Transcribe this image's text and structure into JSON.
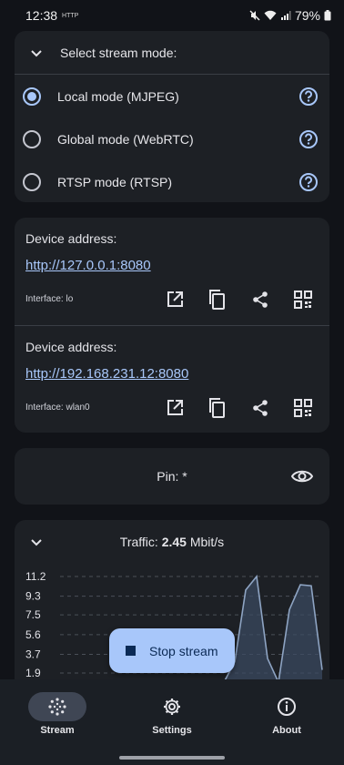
{
  "status_bar": {
    "time": "12:38",
    "extra_icon_text": "HTTP",
    "battery": "79%"
  },
  "stream_mode": {
    "title": "Select stream mode:",
    "options": [
      {
        "label": "Local mode (MJPEG)",
        "selected": true
      },
      {
        "label": "Global mode (WebRTC)",
        "selected": false
      },
      {
        "label": "RTSP mode (RTSP)",
        "selected": false
      }
    ]
  },
  "addresses": [
    {
      "label": "Device address:",
      "url": "http://127.0.0.1:8080",
      "interface": "Interface: lo"
    },
    {
      "label": "Device address:",
      "url": "http://192.168.231.12:8080",
      "interface": "Interface: wlan0"
    }
  ],
  "pin": {
    "text": "Pin: *"
  },
  "traffic": {
    "label": "Traffic:",
    "value": "2.45",
    "unit": "Mbit/s"
  },
  "chart_data": {
    "type": "area",
    "ticks": [
      "11.2",
      "9.3",
      "7.5",
      "5.6",
      "3.7",
      "1.9"
    ],
    "ylim": [
      0,
      13.1
    ],
    "x": [
      0,
      1,
      2,
      3,
      4,
      5,
      6,
      7,
      8,
      9,
      10,
      11,
      12,
      13,
      14,
      15,
      16,
      17,
      18,
      19,
      20,
      21,
      22
    ],
    "values": [
      0,
      0,
      0,
      0,
      0,
      0,
      0,
      0,
      0,
      0,
      0,
      0,
      0,
      0,
      0,
      1.0,
      3.0,
      9.9,
      11.2,
      3.3,
      1.0,
      8.0,
      10.4,
      10.3,
      2.2
    ],
    "grid": true,
    "colors": {
      "line": "#8ea4c3",
      "fill": "#3c4c63",
      "grid": "#4a4f58",
      "tick": "#e3e3e8"
    }
  },
  "fab": {
    "label": "Stop stream"
  },
  "nav": [
    {
      "label": "Stream",
      "icon": "stream-icon",
      "active": true
    },
    {
      "label": "Settings",
      "icon": "settings-icon",
      "active": false
    },
    {
      "label": "About",
      "icon": "about-icon",
      "active": false
    }
  ],
  "colors": {
    "accent": "#a8c7fa",
    "card": "#1d2025",
    "background": "#111318"
  }
}
